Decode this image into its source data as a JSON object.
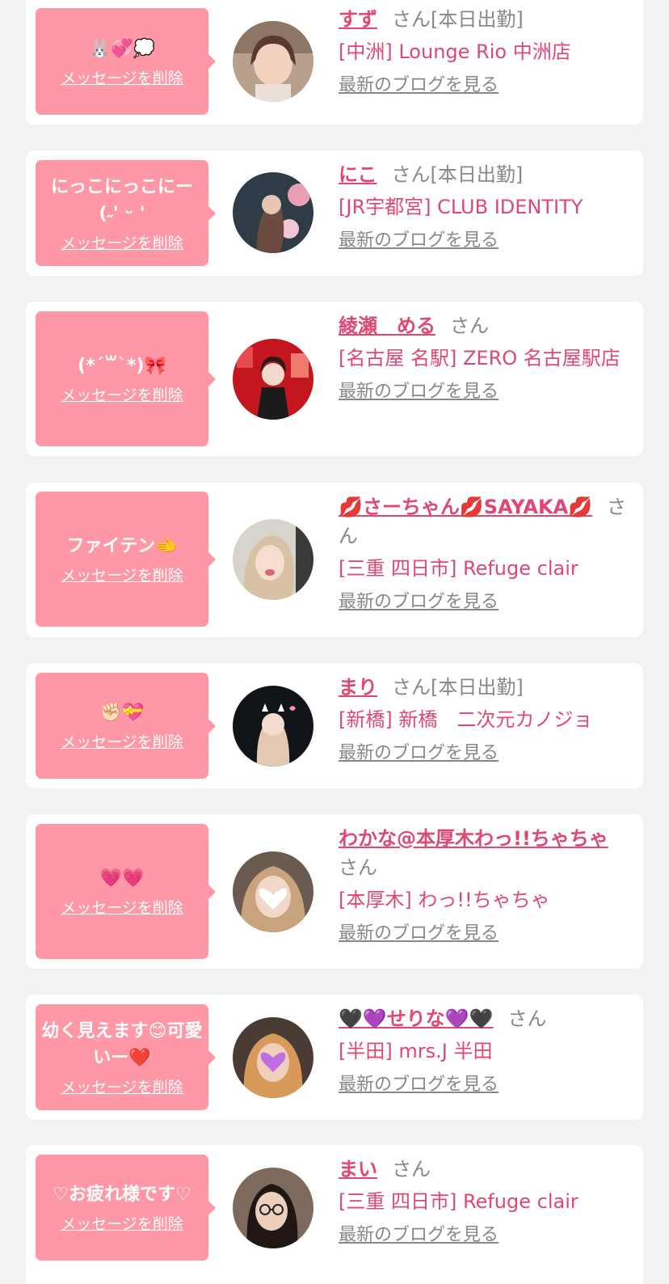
{
  "cards": [
    {
      "message": "🐰💞💭",
      "delete_label": "メッセージを削除",
      "name": "すず",
      "suffix": "さん[本日出勤]",
      "shop": "[中洲] Lounge Rio 中洲店",
      "blog_label": "最新のブログを見る",
      "avatar": "photo-avatar-suzu"
    },
    {
      "message": "にっこにっこにー\n(˶' ᵕ ' ",
      "delete_label": "メッセージを削除",
      "name": "にこ",
      "suffix": "さん[本日出勤]",
      "shop": "[JR宇都宮] CLUB IDENTITY",
      "blog_label": "最新のブログを見る",
      "avatar": "photo-avatar-niko"
    },
    {
      "message": "(*´꒳`*)🎀",
      "delete_label": "メッセージを削除",
      "name": "綾瀬　める",
      "suffix": "さん",
      "shop": "[名古屋 名駅] ZERO 名古屋駅店",
      "blog_label": "最新のブログを見る",
      "avatar": "photo-avatar-meru"
    },
    {
      "message": "ファイテン🫲",
      "delete_label": "メッセージを削除",
      "name": "💋さーちゃん💋SAYAKA💋",
      "suffix": "さん",
      "shop": "[三重 四日市] Refuge clair",
      "blog_label": "最新のブログを見る",
      "avatar": "photo-avatar-sayaka"
    },
    {
      "message": "✊🏻💝",
      "delete_label": "メッセージを削除",
      "name": "まり",
      "suffix": "さん[本日出勤]",
      "shop": "[新橋] 新橋　二次元カノジョ",
      "blog_label": "最新のブログを見る",
      "avatar": "photo-avatar-mari"
    },
    {
      "message": "💗💗",
      "delete_label": "メッセージを削除",
      "name": "わかな@本厚木わっ!!ちゃちゃ",
      "suffix": "さん",
      "shop": "[本厚木] わっ!!ちゃちゃ",
      "blog_label": "最新のブログを見る",
      "avatar": "photo-avatar-wakana"
    },
    {
      "message": "幼く見えます😊可愛いー❤️",
      "delete_label": "メッセージを削除",
      "name": "🖤💜せりな💜🖤",
      "suffix": "さん",
      "shop": "[半田] mrs.J 半田",
      "blog_label": "最新のブログを見る",
      "avatar": "photo-avatar-serina"
    },
    {
      "message": "♡お疲れ様です♡",
      "delete_label": "メッセージを削除",
      "name": "まい",
      "suffix": "さん",
      "shop": "[三重 四日市] Refuge clair",
      "blog_label": "最新のブログを見る",
      "avatar": "photo-avatar-mai"
    }
  ]
}
